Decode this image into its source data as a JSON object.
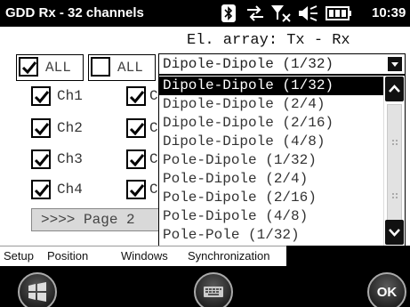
{
  "statusbar": {
    "title": "GDD Rx - 32 channels",
    "time": "10:39",
    "icons": [
      "bluetooth-icon",
      "data-sync-icon",
      "signal-off-icon",
      "volume-icon",
      "battery-icon"
    ]
  },
  "array_label": "El. array: Tx - Rx",
  "all_buttons": [
    {
      "label": "ALL",
      "checked": true
    },
    {
      "label": "ALL",
      "checked": false
    }
  ],
  "channels_col1": [
    {
      "label": "Ch1",
      "checked": true
    },
    {
      "label": "Ch2",
      "checked": true
    },
    {
      "label": "Ch3",
      "checked": true
    },
    {
      "label": "Ch4",
      "checked": true
    }
  ],
  "channels_col2": [
    {
      "label": "C",
      "checked": true
    },
    {
      "label": "C",
      "checked": true
    },
    {
      "label": "C",
      "checked": true
    },
    {
      "label": "C",
      "checked": true
    }
  ],
  "page_button": ">>>> Page 2",
  "combo": {
    "selected": "Dipole-Dipole (1/32)"
  },
  "dropdown_items": [
    "Dipole-Dipole (1/32)",
    "Dipole-Dipole (2/4)",
    "Dipole-Dipole (2/16)",
    "Dipole-Dipole (4/8)",
    "Pole-Dipole (1/32)",
    "Pole-Dipole (2/4)",
    "Pole-Dipole (2/16)",
    "Pole-Dipole (4/8)",
    "Pole-Pole (1/32)"
  ],
  "tabs": [
    "Setup",
    "Position",
    "Windows",
    "Synchronization"
  ],
  "softkeys": {
    "ok": "OK"
  },
  "colors": {
    "bar_bg": "#000000",
    "selection_bg": "#000000",
    "page_button_bg": "#d9d9d9"
  }
}
